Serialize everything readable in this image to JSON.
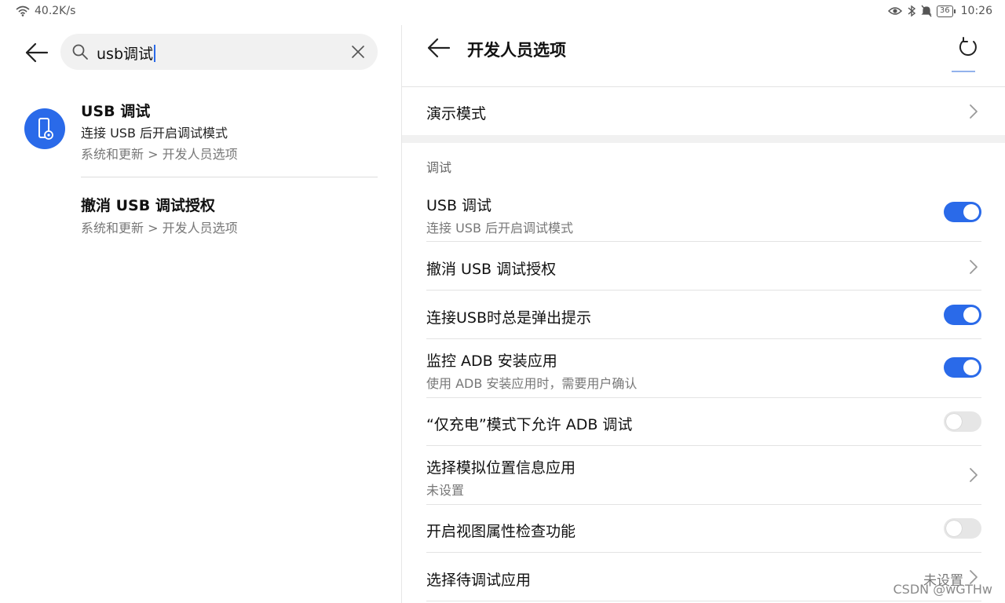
{
  "status_bar": {
    "network_speed": "40.2K/s",
    "battery": "36",
    "time": "10:26"
  },
  "search": {
    "query": "usb调试",
    "clear_icon": "close-icon",
    "search_icon": "search-icon"
  },
  "results": [
    {
      "title": "USB 调试",
      "subtitle": "连接 USB 后开启调试模式",
      "path": "系统和更新 > 开发人员选项"
    },
    {
      "title": "撤消 USB 调试授权",
      "path": "系统和更新 > 开发人员选项"
    }
  ],
  "developer_options": {
    "title": "开发人员选项",
    "demo_mode": "演示模式",
    "section_debug": "调试",
    "items": [
      {
        "label": "USB 调试",
        "sub": "连接 USB 后开启调试模式",
        "toggle": true
      },
      {
        "label": "撤消 USB 调试授权"
      },
      {
        "label": "连接USB时总是弹出提示",
        "toggle": true
      },
      {
        "label": "监控 ADB 安装应用",
        "sub": "使用 ADB 安装应用时，需要用户确认",
        "toggle": true
      },
      {
        "label": "“仅充电”模式下允许 ADB 调试",
        "toggle": false
      },
      {
        "label": "选择模拟位置信息应用",
        "sub": "未设置"
      },
      {
        "label": "开启视图属性检查功能",
        "toggle": false
      },
      {
        "label": "选择待调试应用",
        "value": "未设置"
      }
    ]
  },
  "watermark": "CSDN @wGTHw",
  "colors": {
    "accent": "#2a6ae9",
    "toggle_off": "#e6e6e6",
    "divider": "#e3e3e3"
  }
}
